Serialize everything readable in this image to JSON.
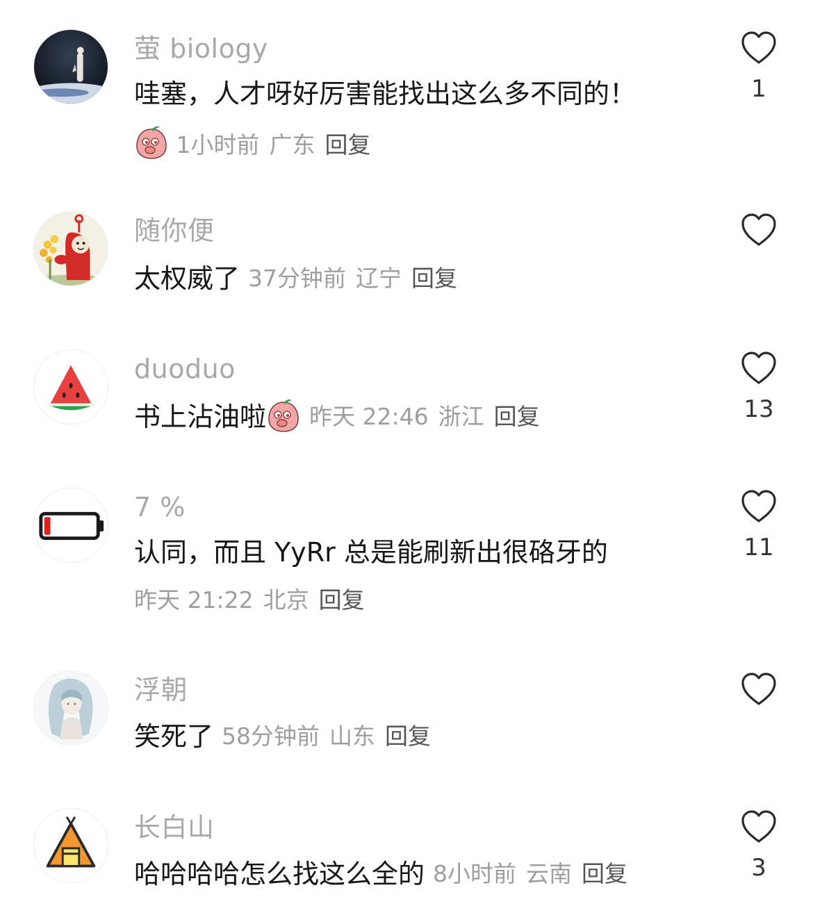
{
  "comments": [
    {
      "name": "萤 biology",
      "text": "哇塞，人才呀好厉害能找出这么多不同的！",
      "time": "1小时前",
      "location": "广东",
      "reply": "回复",
      "likes": "1",
      "avatar_icon": "snow-figure-avatar",
      "meta_sticker": "peach-face-sticker"
    },
    {
      "name": "随你便",
      "text": "太权威了",
      "time": "37分钟前",
      "location": "辽宁",
      "reply": "回复",
      "likes": "",
      "avatar_icon": "red-teletubby-flowers-avatar"
    },
    {
      "name": "duoduo",
      "text": "书上沾油啦",
      "time": "昨天 22:46",
      "location": "浙江",
      "reply": "回复",
      "likes": "13",
      "avatar_icon": "watermelon-avatar",
      "text_sticker": "peach-face-sticker"
    },
    {
      "name": "7 %",
      "text": "认同，而且 YyRr 总是能刷新出很硌牙的",
      "time": "昨天 21:22",
      "location": "北京",
      "reply": "回复",
      "likes": "11",
      "avatar_icon": "low-battery-avatar"
    },
    {
      "name": "浮朝",
      "text": "笑死了",
      "time": "58分钟前",
      "location": "山东",
      "reply": "回复",
      "likes": "",
      "avatar_icon": "pale-anime-girl-avatar"
    },
    {
      "name": "长白山",
      "text": "哈哈哈哈怎么找这么全的",
      "time": "8小时前",
      "location": "云南",
      "reply": "回复",
      "likes": "3",
      "avatar_icon": "orange-tent-avatar"
    }
  ],
  "colors": {
    "name": "#a8a8a8",
    "text": "#161616",
    "meta": "#9e9e9e",
    "reply": "#555555",
    "like_icon": "#2a2a2a"
  }
}
